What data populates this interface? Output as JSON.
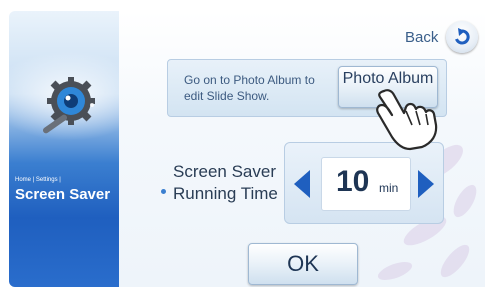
{
  "sidebar": {
    "breadcrumb": "Home | Settings |",
    "title": "Screen Saver",
    "icon": "settings-gear-icon"
  },
  "header": {
    "back_label": "Back",
    "back_icon": "back-arrow-icon"
  },
  "info": {
    "text": "Go on to Photo Album to edit Slide Show.",
    "photo_album_label": "Photo Album"
  },
  "setting": {
    "label": "Screen Saver Running Time",
    "value": "10",
    "unit": "min",
    "decrease_icon": "arrow-left-icon",
    "increase_icon": "arrow-right-icon"
  },
  "footer": {
    "ok_label": "OK"
  },
  "colors": {
    "accent": "#1f5fbf",
    "text_dark": "#1e3554",
    "info_text": "#3c5a80"
  }
}
